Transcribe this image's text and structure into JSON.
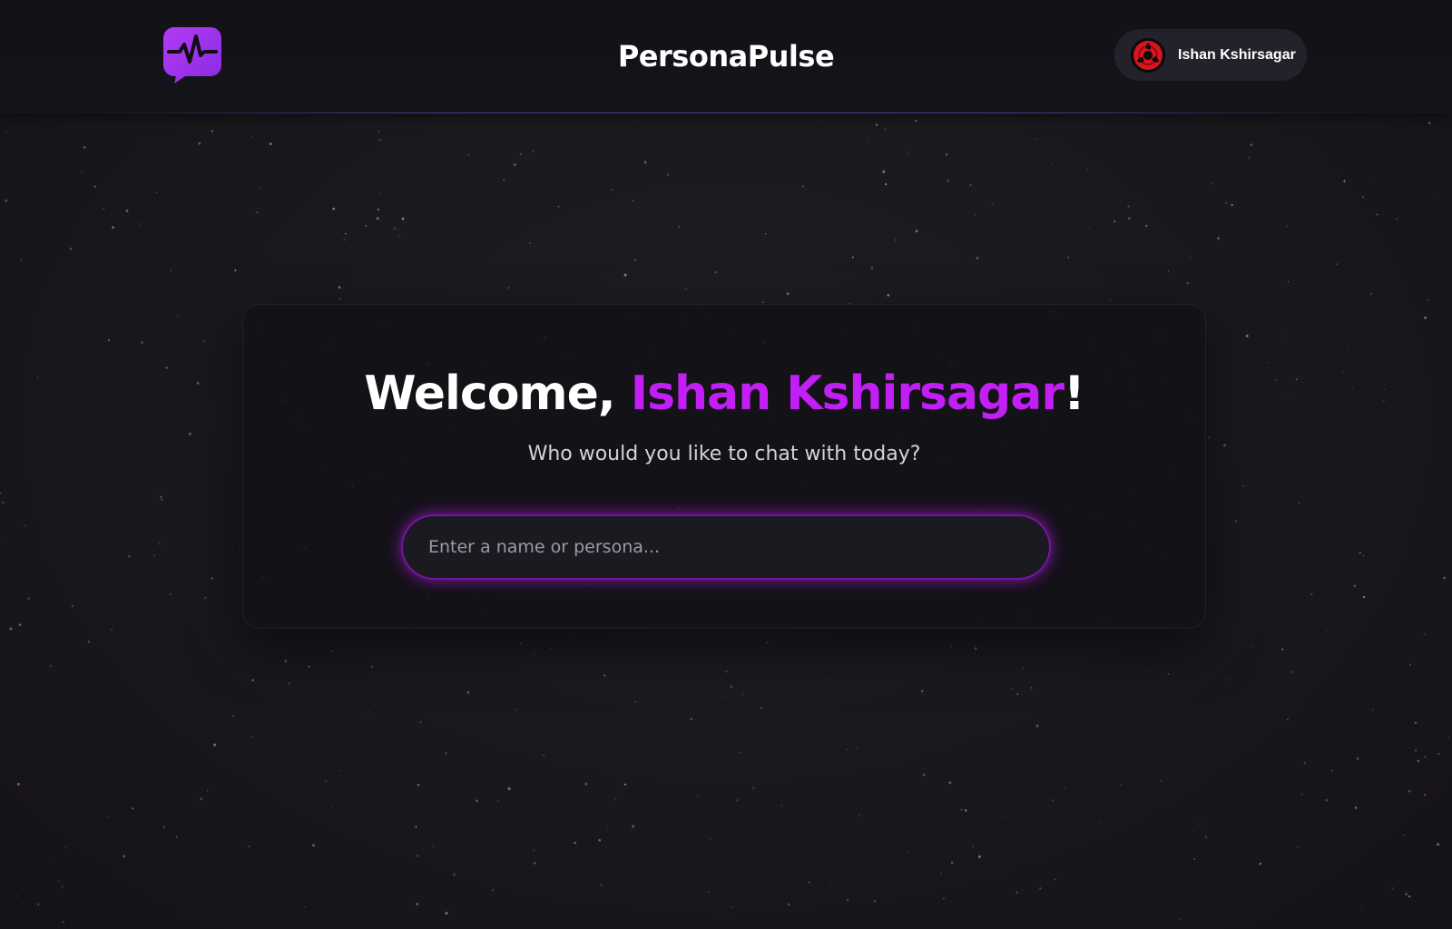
{
  "header": {
    "brand": "PersonaPulse",
    "user_name": "Ishan Kshirsagar",
    "logo_icon": "chat-pulse-icon",
    "avatar_icon": "red-sharingan-icon"
  },
  "main": {
    "welcome_prefix": "Welcome, ",
    "welcome_name": "Ishan Kshirsagar",
    "welcome_suffix": "!",
    "subtitle": "Who would you like to chat with today?",
    "search_placeholder": "Enter a name or persona...",
    "search_value": ""
  },
  "colors": {
    "accent": "#c21ff5",
    "background": "#19181d",
    "card": "#121116",
    "avatar_red": "#d8141d"
  }
}
